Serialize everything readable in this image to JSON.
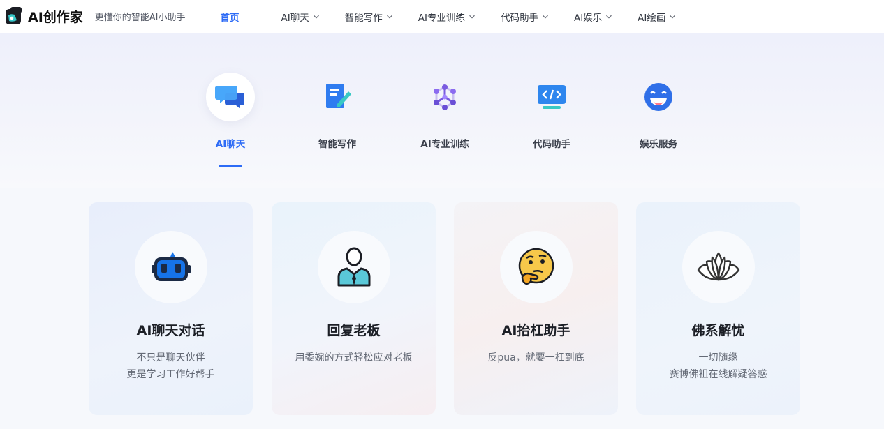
{
  "brand": {
    "name": "AI创作家",
    "slogan": "更懂你的智能AI小助手"
  },
  "nav": [
    {
      "label": "首页",
      "active": true,
      "dropdown": false
    },
    {
      "label": "AI聊天",
      "dropdown": true
    },
    {
      "label": "智能写作",
      "dropdown": true
    },
    {
      "label": "AI专业训练",
      "dropdown": true
    },
    {
      "label": "代码助手",
      "dropdown": true
    },
    {
      "label": "AI娱乐",
      "dropdown": true
    },
    {
      "label": "AI绘画",
      "dropdown": true
    }
  ],
  "tabs": [
    {
      "label": "AI聊天",
      "icon": "chat-bubbles-icon",
      "active": true
    },
    {
      "label": "智能写作",
      "icon": "document-pen-icon"
    },
    {
      "label": "AI专业训练",
      "icon": "network-cube-icon"
    },
    {
      "label": "代码助手",
      "icon": "code-monitor-icon"
    },
    {
      "label": "娱乐服务",
      "icon": "laughing-face-icon"
    }
  ],
  "cards": [
    {
      "title": "AI聊天对话",
      "desc": [
        "不只是聊天伙伴",
        "更是学习工作好帮手"
      ],
      "icon": "robot-chat-icon"
    },
    {
      "title": "回复老板",
      "desc": [
        "用委婉的方式轻松应对老板"
      ],
      "icon": "businessman-icon"
    },
    {
      "title": "AI抬杠助手",
      "desc": [
        "反pua，就要一杠到底"
      ],
      "icon": "thinking-face-icon"
    },
    {
      "title": "佛系解忧",
      "desc": [
        "一切随缘",
        "赛博佛祖在线解疑答惑"
      ],
      "icon": "lotus-icon"
    }
  ],
  "colors": {
    "accent": "#2d6bf6",
    "tab_icon": "#3a8ef6",
    "robot": "#1673e8",
    "lotus": "#333333"
  }
}
